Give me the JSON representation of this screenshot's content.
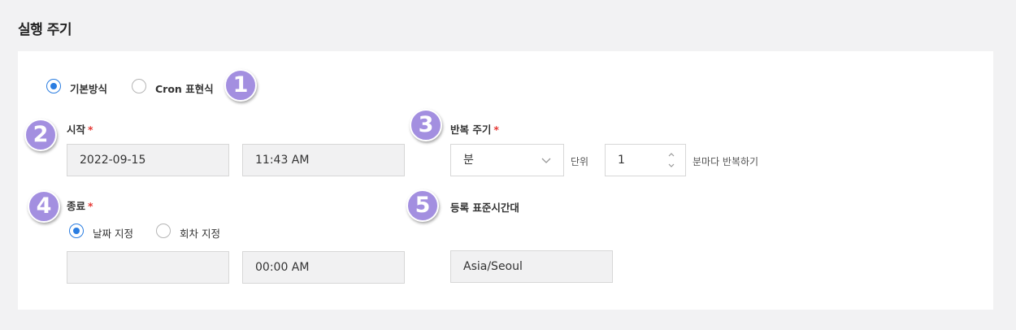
{
  "section_title": "실행 주기",
  "mode": {
    "options": [
      {
        "label": "기본방식",
        "selected": true
      },
      {
        "label": "Cron 표현식",
        "selected": false
      }
    ]
  },
  "badges": [
    "1",
    "2",
    "3",
    "4",
    "5"
  ],
  "start": {
    "label": "시작",
    "required": "*",
    "date": "2022-09-15",
    "time": "11:43 AM"
  },
  "repeat": {
    "label": "반복 주기",
    "required": "*",
    "unit_select": "분",
    "unit_label": "단위",
    "interval": "1",
    "suffix": "분마다 반복하기"
  },
  "end": {
    "label": "종료",
    "required": "*",
    "options": [
      {
        "label": "날짜 지정",
        "selected": true
      },
      {
        "label": "회차 지정",
        "selected": false
      }
    ],
    "date": "",
    "time": "00:00 AM"
  },
  "timezone": {
    "label": "등록 표준시간대",
    "value": "Asia/Seoul"
  },
  "colors": {
    "accent": "#2a7de1",
    "badge": "#a38fe0",
    "required": "#e53935"
  }
}
